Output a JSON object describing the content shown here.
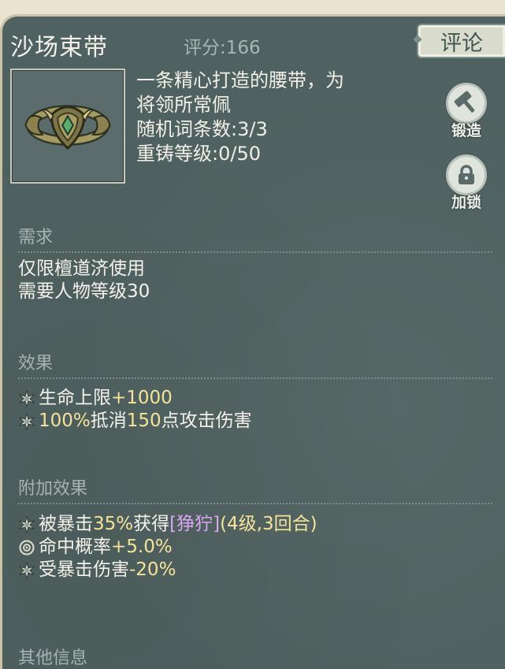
{
  "item": {
    "name": "沙场束带",
    "score": "评分:166",
    "description_lines": [
      "一条精心打造的腰带，为",
      "将领所常佩",
      "随机词条数:3/3",
      "重铸等级:0/50"
    ],
    "icon": "belt-icon"
  },
  "buttons": {
    "comment": "评论",
    "forge": "锻造",
    "lock": "加锁"
  },
  "sections": {
    "requirements": {
      "heading": "需求",
      "lines": [
        "仅限檀道济使用",
        "需要人物等级30"
      ]
    },
    "effects": {
      "heading": "效果",
      "rows": [
        {
          "icon": "spark-icon",
          "parts": [
            {
              "t": "生命上限",
              "c": ""
            },
            {
              "t": "+1000",
              "c": "y"
            }
          ]
        },
        {
          "icon": "spark-icon",
          "parts": [
            {
              "t": "100%",
              "c": "y"
            },
            {
              "t": "抵消",
              "c": ""
            },
            {
              "t": "150",
              "c": "y"
            },
            {
              "t": "点攻击伤害",
              "c": ""
            }
          ]
        }
      ]
    },
    "bonus": {
      "heading": "附加效果",
      "rows": [
        {
          "icon": "spark-icon",
          "parts": [
            {
              "t": "被暴击",
              "c": ""
            },
            {
              "t": "35%",
              "c": "y"
            },
            {
              "t": "获得",
              "c": ""
            },
            {
              "t": "[狰狞]",
              "c": "p"
            },
            {
              "t": "(4级,3回合)",
              "c": "y"
            }
          ]
        },
        {
          "icon": "target-icon",
          "parts": [
            {
              "t": "命中概率",
              "c": ""
            },
            {
              "t": "+5.0%",
              "c": "y"
            }
          ]
        },
        {
          "icon": "spark-icon",
          "parts": [
            {
              "t": "受暴击伤害",
              "c": ""
            },
            {
              "t": "-20%",
              "c": "y"
            }
          ]
        }
      ]
    },
    "other": {
      "heading": "其他信息"
    }
  },
  "colors": {
    "panel": "#4f6160",
    "highlight": "#f5e39a",
    "buff_name": "#d8a6f0",
    "heading": "#a8b3b1"
  }
}
